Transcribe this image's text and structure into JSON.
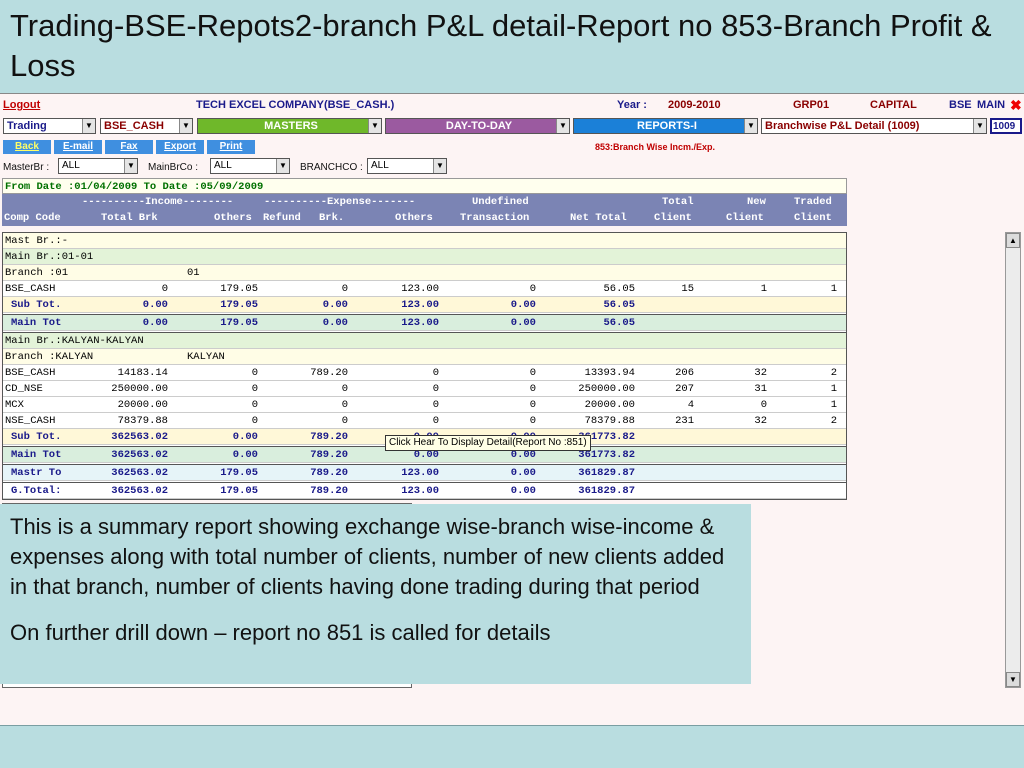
{
  "slide": {
    "title": "Trading-BSE-Repots2-branch P&L detail-Report no 853-Branch Profit & Loss",
    "description_1": "This is a summary report showing exchange wise-branch wise-income & expenses along with total number of clients, number of new clients added in that branch, number of clients having done trading during that period",
    "description_2": "On further drill down – report no 851 is called  for details"
  },
  "header": {
    "logout": "Logout",
    "company": "TECH EXCEL COMPANY(BSE_CASH.)",
    "year_label": "Year :",
    "year": "2009-2010",
    "group": "GRP01",
    "capital": "CAPITAL",
    "exchange": "BSE",
    "main": "MAIN",
    "close": "✖"
  },
  "menus": {
    "trading": "Trading",
    "segment": "BSE_CASH",
    "masters": "MASTERS",
    "day_to_day": "DAY-TO-DAY",
    "reports": "REPORTS-I",
    "report_select": "Branchwise P&L Detail (1009)",
    "report_code": "1009"
  },
  "toolbar": {
    "back": "Back",
    "email": "E-mail",
    "fax": "Fax",
    "export": "Export",
    "print": "Print",
    "report_name": "853:Branch Wise Incm./Exp."
  },
  "filters": {
    "master_br_label": "MasterBr :",
    "master_br": "ALL",
    "main_br_label": "MainBrCo :",
    "main_br": "ALL",
    "branch_label": "BRANCHCO :",
    "branch": "ALL"
  },
  "report": {
    "date_range": "From Date :01/04/2009   To Date :05/09/2009",
    "group_header": {
      "income": "----------Income--------",
      "expense": "----------Expense-------",
      "undefined": "Undefined",
      "total": "Total",
      "new": "New",
      "traded": "Traded"
    },
    "columns": {
      "comp_code": "Comp Code",
      "total_brk": "Total Brk",
      "others": "Others",
      "refund": "Refund",
      "brk": "Brk.",
      "exp_others": "Others",
      "transaction": "Transaction",
      "net_total": "Net Total",
      "client1": "Client",
      "client2": "Client",
      "client3": "Client"
    },
    "mast_br": "Mast Br.:-",
    "main_br_1": "Main Br.:01-01",
    "branch_1": "Branch :01",
    "branch_1_name": "01",
    "rows_1": [
      {
        "code": "BSE_CASH",
        "total_brk": "0",
        "others": "179.05",
        "refund": "0",
        "brk": "123.00",
        "undefined": "0",
        "net": "56.05",
        "total": "15",
        "new": "1",
        "traded": "1"
      }
    ],
    "sub_1": {
      "label": "Sub Tot.",
      "total_brk": "0.00",
      "others": "179.05",
      "refund": "0.00",
      "brk": "123.00",
      "undefined": "0.00",
      "net": "56.05"
    },
    "main_1": {
      "label": "Main Tot",
      "total_brk": "0.00",
      "others": "179.05",
      "refund": "0.00",
      "brk": "123.00",
      "undefined": "0.00",
      "net": "56.05"
    },
    "main_br_2": "Main Br.:KALYAN-KALYAN",
    "branch_2": "Branch :KALYAN",
    "branch_2_name": "KALYAN",
    "rows_2": [
      {
        "code": "BSE_CASH",
        "total_brk": "14183.14",
        "others": "0",
        "refund": "789.20",
        "brk": "0",
        "undefined": "0",
        "net": "13393.94",
        "total": "206",
        "new": "32",
        "traded": "2"
      },
      {
        "code": "CD_NSE",
        "total_brk": "250000.00",
        "others": "0",
        "refund": "0",
        "brk": "0",
        "undefined": "0",
        "net": "250000.00",
        "total": "207",
        "new": "31",
        "traded": "1"
      },
      {
        "code": "MCX",
        "total_brk": "20000.00",
        "others": "0",
        "refund": "0",
        "brk": "0",
        "undefined": "0",
        "net": "20000.00",
        "total": "4",
        "new": "0",
        "traded": "1"
      },
      {
        "code": "NSE_CASH",
        "total_brk": "78379.88",
        "others": "0",
        "refund": "0",
        "brk": "0",
        "undefined": "0",
        "net": "78379.88",
        "total": "231",
        "new": "32",
        "traded": "2"
      }
    ],
    "sub_2": {
      "label": "Sub Tot.",
      "total_brk": "362563.02",
      "others": "0.00",
      "refund": "789.20",
      "brk": "0.00",
      "undefined": "0.00",
      "net": "361773.82"
    },
    "main_2": {
      "label": "Main Tot",
      "total_brk": "362563.02",
      "others": "0.00",
      "refund": "789.20",
      "brk": "0.00",
      "undefined": "0.00",
      "net": "361773.82"
    },
    "mastr": {
      "label": "Mastr To",
      "total_brk": "362563.02",
      "others": "179.05",
      "refund": "789.20",
      "brk": "123.00",
      "undefined": "0.00",
      "net": "361829.87"
    },
    "gtotal": {
      "label": "G.Total:",
      "total_brk": "362563.02",
      "others": "179.05",
      "refund": "789.20",
      "brk": "123.00",
      "undefined": "0.00",
      "net": "361829.87"
    },
    "tooltip": "Click Hear To Display Detail(Report No :851)"
  },
  "scroll": {
    "up": "▲",
    "down": "▼"
  },
  "arrow": "▼"
}
